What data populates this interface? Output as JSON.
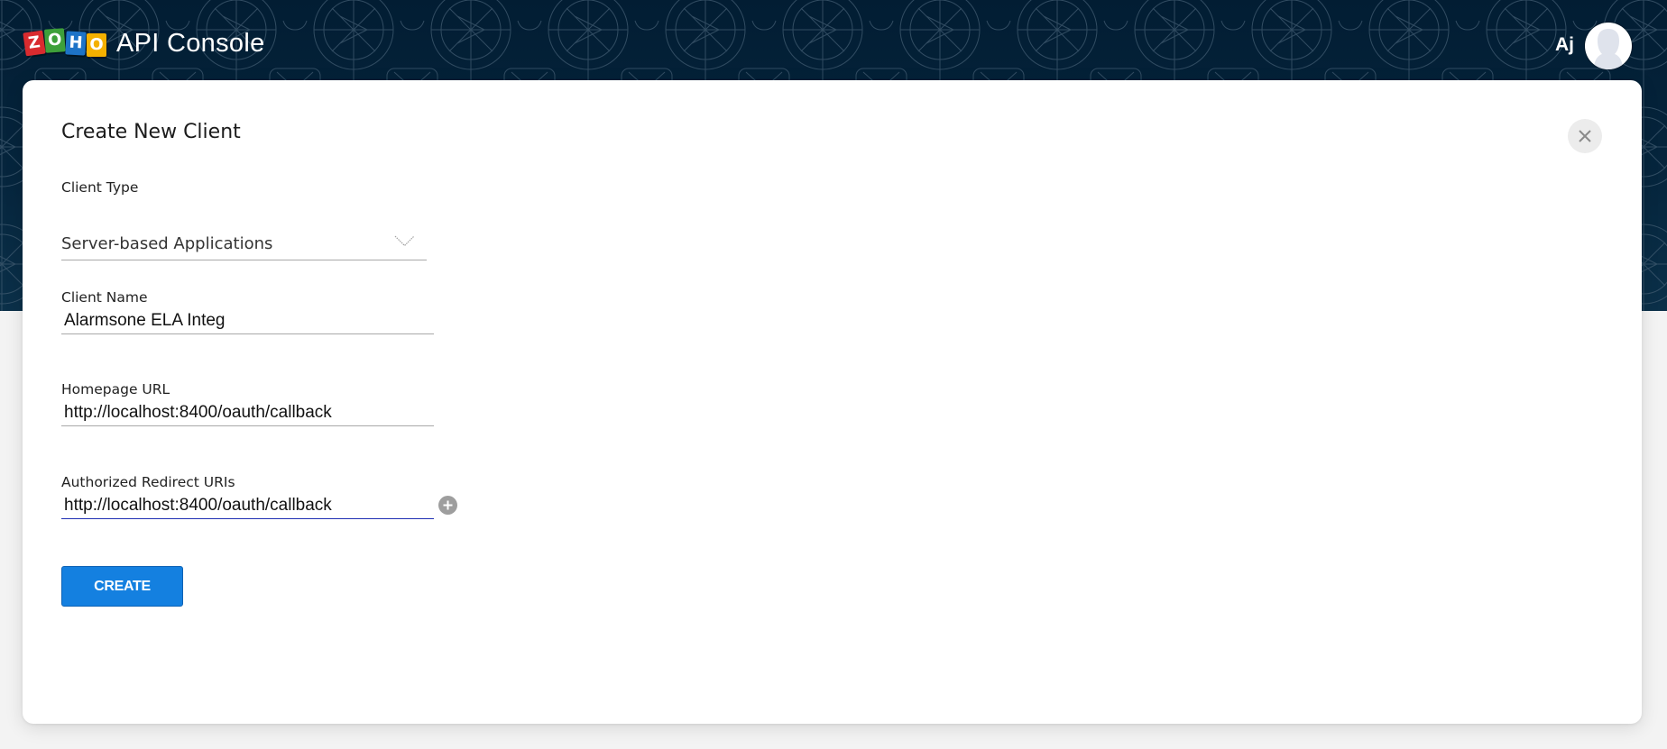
{
  "header": {
    "logo_letters": [
      "Z",
      "O",
      "H",
      "O"
    ],
    "app_title": "API Console",
    "user_initials": "Aj",
    "icons": {
      "avatar": "user-avatar-icon"
    }
  },
  "dialog": {
    "title": "Create New Client",
    "close_icon": "close-icon",
    "fields": {
      "client_type": {
        "label": "Client Type",
        "value": "Server-based Applications",
        "icon": "chevron-down-icon"
      },
      "client_name": {
        "label": "Client Name",
        "value": "Alarmsone ELA Integ"
      },
      "homepage_url": {
        "label": "Homepage URL",
        "value": "http://localhost:8400/oauth/callback"
      },
      "redirect_uris": {
        "label": "Authorized Redirect URIs",
        "value": "http://localhost:8400/oauth/callback",
        "add_icon": "plus-circle-icon"
      }
    },
    "create_button": "CREATE"
  },
  "colors": {
    "header_bg": "#021d33",
    "primary_button": "#1480e0",
    "focus_underline": "#1f2fb3",
    "logo": [
      "#d92b2f",
      "#3ea03a",
      "#1d73c7",
      "#f4b000"
    ]
  }
}
